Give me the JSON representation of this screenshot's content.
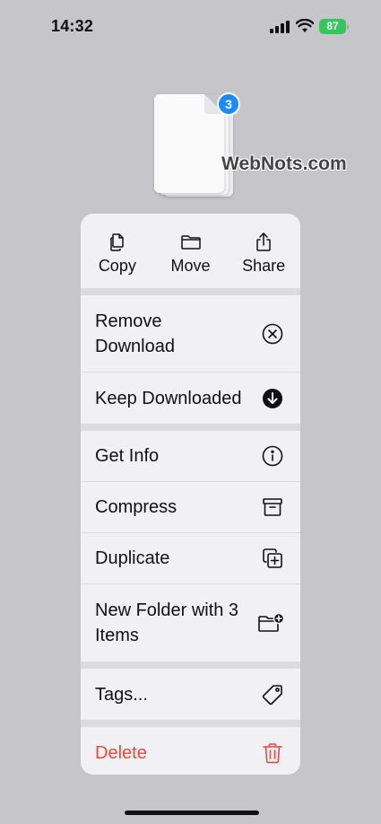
{
  "status_bar": {
    "time": "14:32",
    "battery": "87",
    "icons": [
      "signal-icon",
      "wifi-icon",
      "battery-icon"
    ]
  },
  "preview": {
    "badge_count": "3",
    "watermark": "WebNots.com"
  },
  "quick_actions": [
    {
      "label": "Copy",
      "icon": "copy-icon"
    },
    {
      "label": "Move",
      "icon": "folder-icon"
    },
    {
      "label": "Share",
      "icon": "share-icon"
    }
  ],
  "menu": {
    "remove_download": {
      "label": "Remove Download",
      "icon": "x-circle-icon"
    },
    "keep_downloaded": {
      "label": "Keep Downloaded",
      "icon": "download-circle-icon"
    },
    "get_info": {
      "label": "Get Info",
      "icon": "info-icon"
    },
    "compress": {
      "label": "Compress",
      "icon": "archive-box-icon"
    },
    "duplicate": {
      "label": "Duplicate",
      "icon": "duplicate-icon"
    },
    "new_folder": {
      "label": "New Folder with 3 Items",
      "icon": "folder-plus-icon"
    },
    "tags": {
      "label": "Tags...",
      "icon": "tag-icon"
    },
    "delete": {
      "label": "Delete",
      "icon": "trash-icon"
    }
  },
  "colors": {
    "background": "#c6c5ca",
    "menu_background": "#f1f1f3",
    "badge": "#1a8cff",
    "battery": "#34c759",
    "destructive": "#e5483f"
  }
}
